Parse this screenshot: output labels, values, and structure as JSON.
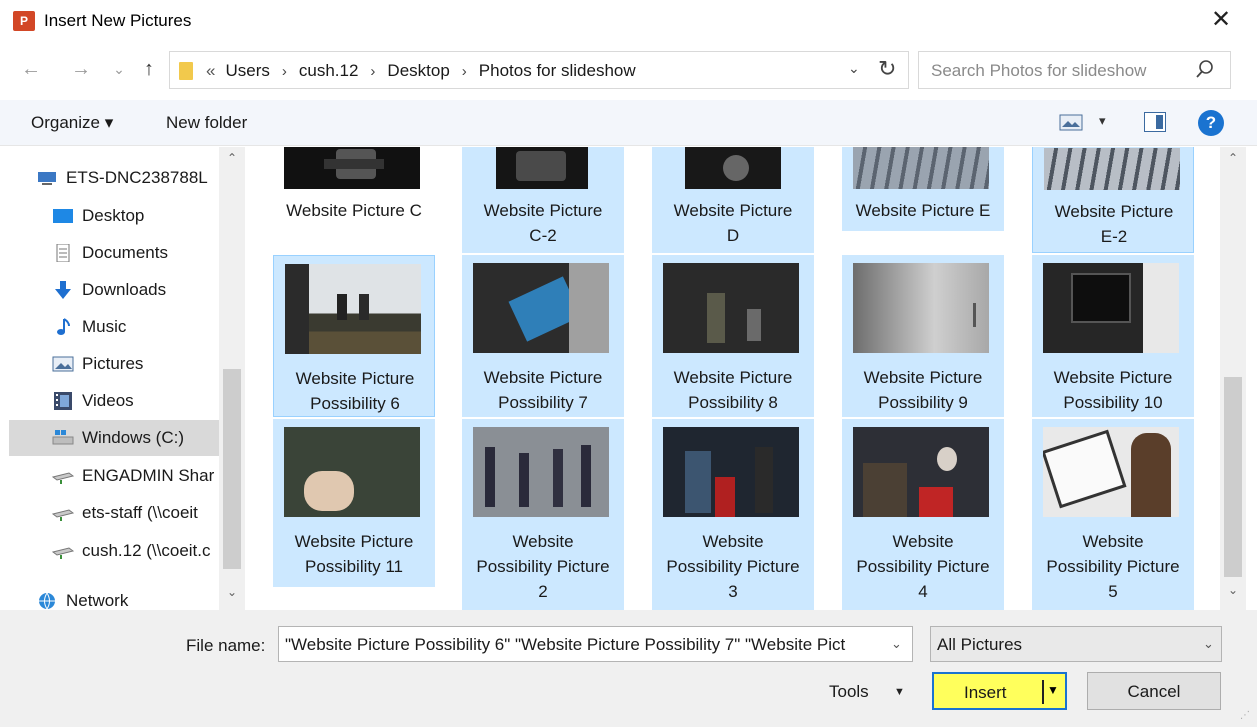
{
  "window": {
    "title": "Insert New Pictures",
    "app_icon_text": "P",
    "close_glyph": "✕"
  },
  "nav": {
    "back_glyph": "←",
    "forward_glyph": "→",
    "history_glyph": "⌄",
    "up_glyph": "↑",
    "crumb_overflow": "«",
    "breadcrumbs": [
      "Users",
      "cush.12",
      "Desktop",
      "Photos for slideshow"
    ],
    "separator": "›",
    "refresh_glyph": "↻",
    "dropdown_glyph": "⌄"
  },
  "search": {
    "placeholder": "Search Photos for slideshow"
  },
  "toolbar": {
    "organize_label": "Organize ▾",
    "new_folder_label": "New folder",
    "view_dd_glyph": "▾",
    "help_glyph": "?"
  },
  "sidebar": {
    "items": [
      {
        "label": "ETS-DNC238788L",
        "icon": "computer-icon"
      },
      {
        "label": "Desktop",
        "icon": "desktop-icon"
      },
      {
        "label": "Documents",
        "icon": "documents-icon"
      },
      {
        "label": "Downloads",
        "icon": "downloads-icon"
      },
      {
        "label": "Music",
        "icon": "music-icon"
      },
      {
        "label": "Pictures",
        "icon": "pictures-icon"
      },
      {
        "label": "Videos",
        "icon": "videos-icon"
      },
      {
        "label": "Windows (C:)",
        "icon": "drive-icon"
      },
      {
        "label": "ENGADMIN Shar",
        "icon": "network-drive-icon"
      },
      {
        "label": "ets-staff (\\\\coeit",
        "icon": "network-drive-icon"
      },
      {
        "label": "cush.12 (\\\\coeit.c",
        "icon": "network-drive-icon"
      },
      {
        "label": "Network",
        "icon": "network-icon"
      }
    ],
    "selected_index": 7
  },
  "files": {
    "row1": [
      {
        "name": "Website Picture C",
        "selected": false
      },
      {
        "name": "Website Picture C-2",
        "selected": true
      },
      {
        "name": "Website Picture D",
        "selected": true
      },
      {
        "name": "Website Picture E",
        "selected": true
      },
      {
        "name": "Website Picture E-2",
        "selected": true
      }
    ],
    "row2": [
      {
        "name": "Website Picture Possibility 6",
        "selected": true
      },
      {
        "name": "Website Picture Possibility 7",
        "selected": true
      },
      {
        "name": "Website Picture Possibility 8",
        "selected": true
      },
      {
        "name": "Website Picture Possibility 9",
        "selected": true
      },
      {
        "name": "Website Picture Possibility 10",
        "selected": true
      }
    ],
    "row3": [
      {
        "name": "Website Picture Possibility 11",
        "selected": true
      },
      {
        "name": "Website Possibility Picture 2",
        "selected": true
      },
      {
        "name": "Website Possibility Picture 3",
        "selected": true
      },
      {
        "name": "Website Possibility Picture 4",
        "selected": true
      },
      {
        "name": "Website Possibility Picture 5",
        "selected": true
      }
    ],
    "row1_labels": [
      [
        "Website Picture C"
      ],
      [
        "Website Picture",
        "C-2"
      ],
      [
        "Website Picture",
        "D"
      ],
      [
        "Website Picture E"
      ],
      [
        "Website Picture",
        "E-2"
      ]
    ],
    "row2_labels": [
      [
        "Website Picture",
        "Possibility 6"
      ],
      [
        "Website Picture",
        "Possibility 7"
      ],
      [
        "Website Picture",
        "Possibility 8"
      ],
      [
        "Website Picture",
        "Possibility 9"
      ],
      [
        "Website Picture",
        "Possibility 10"
      ]
    ],
    "row3_labels": [
      [
        "Website Picture",
        "Possibility 11"
      ],
      [
        "Website",
        "Possibility Picture",
        "2"
      ],
      [
        "Website",
        "Possibility Picture",
        "3"
      ],
      [
        "Website",
        "Possibility Picture",
        "4"
      ],
      [
        "Website",
        "Possibility Picture",
        "5"
      ]
    ]
  },
  "footer": {
    "file_name_label": "File name:",
    "file_name_value": "\"Website Picture Possibility 6\" \"Website Picture Possibility 7\" \"Website Pict",
    "filter_value": "All Pictures",
    "tools_label": "Tools",
    "tools_dd_glyph": "▼",
    "insert_label": "Insert",
    "insert_dd_glyph": "▼",
    "cancel_label": "Cancel",
    "dd_glyph": "⌄"
  },
  "scroll": {
    "up_glyph": "⌃",
    "down_glyph": "⌄"
  },
  "colors": {
    "selection": "#cce8ff",
    "insert_highlight": "#ffff5c",
    "accent": "#1a73d0"
  }
}
